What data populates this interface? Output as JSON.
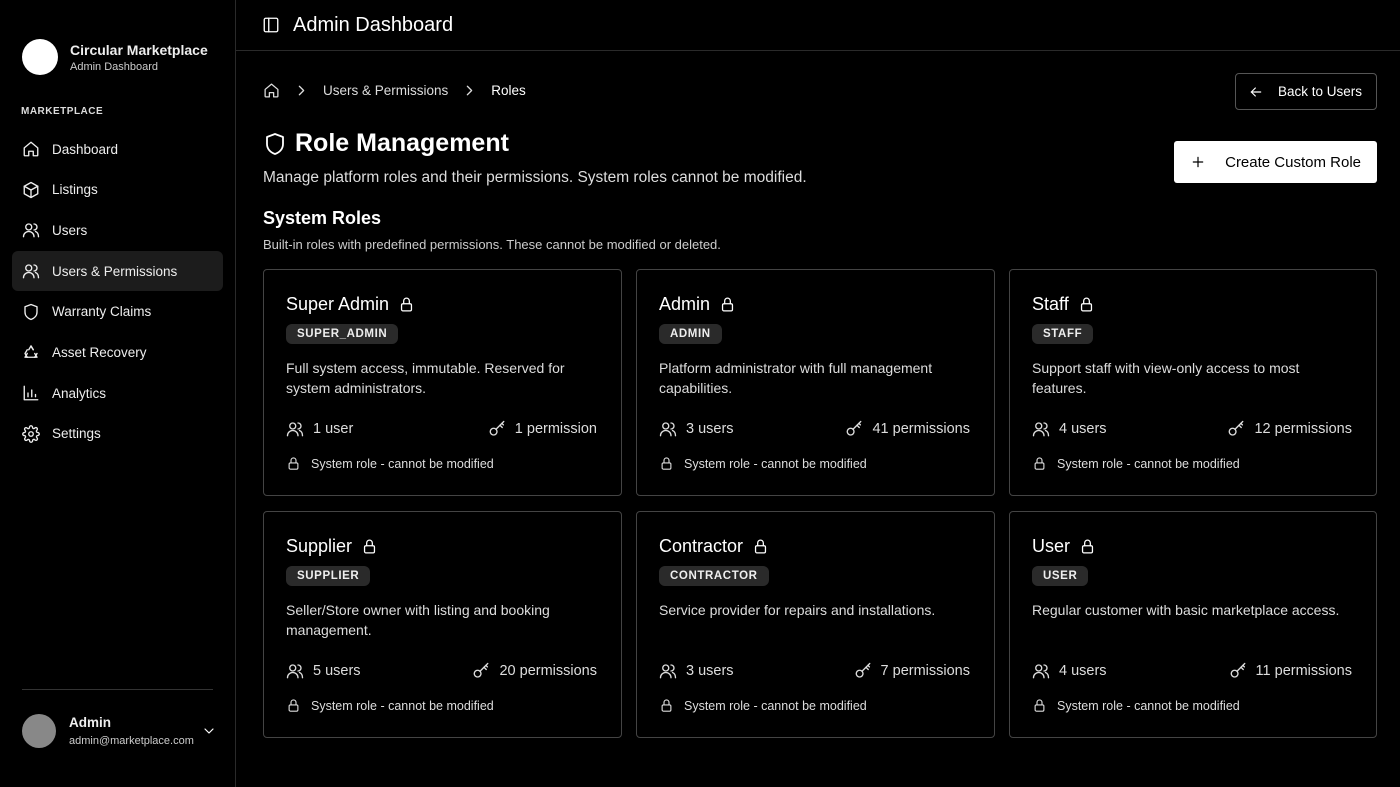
{
  "brand": {
    "name": "Circular Marketplace",
    "sub": "Admin Dashboard"
  },
  "sidebar": {
    "section_label": "MARKETPLACE",
    "items": [
      {
        "label": "Dashboard",
        "icon": "home-icon"
      },
      {
        "label": "Listings",
        "icon": "package-icon"
      },
      {
        "label": "Users",
        "icon": "users-icon"
      },
      {
        "label": "Users & Permissions",
        "icon": "user-permissions-icon",
        "active": true
      },
      {
        "label": "Warranty Claims",
        "icon": "shield-icon"
      },
      {
        "label": "Asset Recovery",
        "icon": "recycle-icon"
      },
      {
        "label": "Analytics",
        "icon": "chart-icon"
      },
      {
        "label": "Settings",
        "icon": "gear-icon"
      }
    ]
  },
  "user": {
    "name": "Admin",
    "email": "admin@marketplace.com"
  },
  "topbar": {
    "title": "Admin Dashboard"
  },
  "breadcrumb": {
    "item1": "Users & Permissions",
    "item2": "Roles"
  },
  "buttons": {
    "back": "Back to Users",
    "create": "Create Custom Role"
  },
  "page": {
    "title": "Role Management",
    "description": "Manage platform roles and their permissions. System roles cannot be modified."
  },
  "system_roles": {
    "title": "System Roles",
    "description": "Built-in roles with predefined permissions. These cannot be modified or deleted.",
    "footer_text": "System role - cannot be modified",
    "cards": [
      {
        "name": "Super Admin",
        "badge": "SUPER_ADMIN",
        "description": "Full system access, immutable. Reserved for system administrators.",
        "users": "1 user",
        "permissions": "1 permission"
      },
      {
        "name": "Admin",
        "badge": "ADMIN",
        "description": "Platform administrator with full management capabilities.",
        "users": "3 users",
        "permissions": "41 permissions"
      },
      {
        "name": "Staff",
        "badge": "STAFF",
        "description": "Support staff with view-only access to most features.",
        "users": "4 users",
        "permissions": "12 permissions"
      },
      {
        "name": "Supplier",
        "badge": "SUPPLIER",
        "description": "Seller/Store owner with listing and booking management.",
        "users": "5 users",
        "permissions": "20 permissions"
      },
      {
        "name": "Contractor",
        "badge": "CONTRACTOR",
        "description": "Service provider for repairs and installations.",
        "users": "3 users",
        "permissions": "7 permissions"
      },
      {
        "name": "User",
        "badge": "USER",
        "description": "Regular customer with basic marketplace access.",
        "users": "4 users",
        "permissions": "11 permissions"
      }
    ]
  }
}
